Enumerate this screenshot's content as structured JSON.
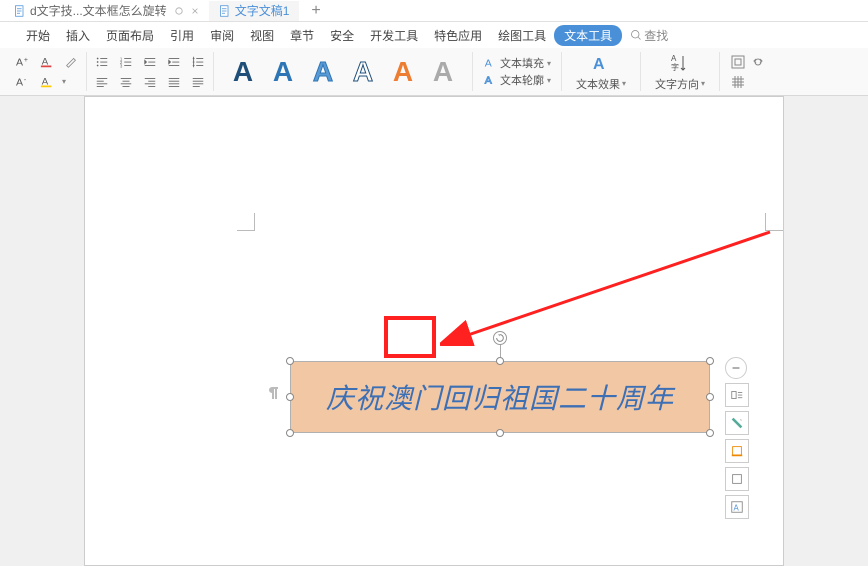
{
  "tabs": [
    {
      "label": "d文字技...文本框怎么旋转",
      "active": false
    },
    {
      "label": "文字文稿1",
      "active": true
    }
  ],
  "menu": [
    "开始",
    "插入",
    "页面布局",
    "引用",
    "审阅",
    "视图",
    "章节",
    "安全",
    "开发工具",
    "特色应用",
    "绘图工具",
    "文本工具"
  ],
  "search_label": "查找",
  "ribbon": {
    "wordart_letters": [
      "A",
      "A",
      "A",
      "A",
      "A",
      "A"
    ],
    "text_fill": "文本填充",
    "text_outline": "文本轮廓",
    "text_effects": "文本效果",
    "text_direction": "文字方向"
  },
  "textbox_content": "庆祝澳门回归祖国二十周年"
}
